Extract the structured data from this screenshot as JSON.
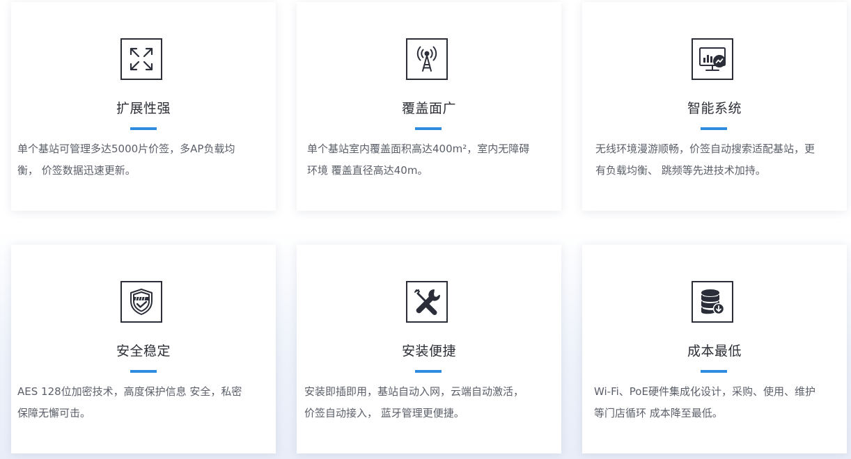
{
  "features": [
    {
      "icon": "expand-arrows-icon",
      "title": "扩展性强",
      "desc_line1": "单个基站可管理多达5000片价签，多AP负载均",
      "desc_line2": "衡， 价签数据迅速更新。"
    },
    {
      "icon": "signal-tower-icon",
      "title": "覆盖面广",
      "desc_line1": "单个基站室内覆盖面积高达400m²，室内无障碍",
      "desc_line2": "环境 覆盖直径高达40m。"
    },
    {
      "icon": "smart-monitor-icon",
      "title": "智能系统",
      "desc_line1": "无线环境漫游顺畅，价签自动搜索适配基站，更",
      "desc_line2": "有负载均衡、 跳频等先进技术加持。"
    },
    {
      "icon": "shield-check-icon",
      "title": "安全稳定",
      "desc_line1": "AES 128位加密技术，高度保护信息 安全，私密",
      "desc_line2": "保障无懈可击。"
    },
    {
      "icon": "tools-icon",
      "title": "安装便捷",
      "desc_line1": "安装即插即用，基站自动入网，云端自动激活，",
      "desc_line2": "价签自动接入， 蓝牙管理更便捷。"
    },
    {
      "icon": "database-download-icon",
      "title": "成本最低",
      "desc_line1": "Wi-Fi、PoE硬件集成化设计，采购、使用、维护",
      "desc_line2": "等门店循环 成本降至最低。"
    }
  ],
  "colors": {
    "accent": "#2d8be0",
    "title": "#2c2f36",
    "text": "#5b5f69"
  }
}
